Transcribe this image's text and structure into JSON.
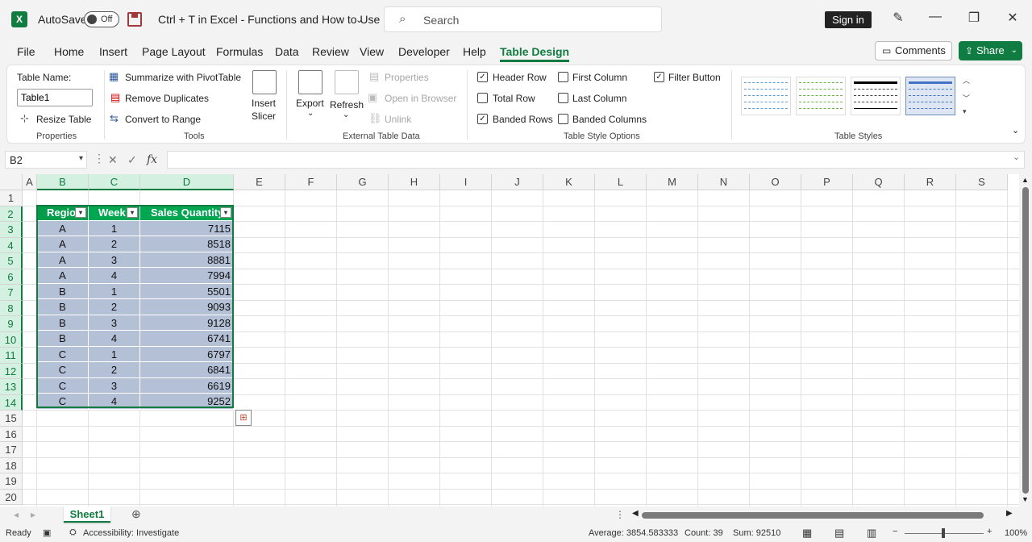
{
  "titlebar": {
    "app_icon": "excel-logo-icon",
    "logo_text": "X",
    "autosave_label": "AutoSave",
    "autosave_state": "Off",
    "doc_title": "Ctrl + T in Excel - Functions and How to Use It",
    "search_placeholder": "Search",
    "signin_label": "Sign in"
  },
  "menu": {
    "tabs": [
      "File",
      "Home",
      "Insert",
      "Page Layout",
      "Formulas",
      "Data",
      "Review",
      "View",
      "Developer",
      "Help",
      "Table Design"
    ],
    "active_tab": "Table Design",
    "comments_label": "Comments",
    "share_label": "Share"
  },
  "ribbon": {
    "properties": {
      "table_name_label": "Table Name:",
      "table_name_value": "Table1",
      "resize_label": "Resize Table",
      "group_label": "Properties"
    },
    "tools": {
      "pivot_label": "Summarize with PivotTable",
      "remove_dup_label": "Remove Duplicates",
      "convert_label": "Convert to Range",
      "group_label": "Tools"
    },
    "slicer": {
      "label1": "Insert",
      "label2": "Slicer"
    },
    "external": {
      "export_label": "Export",
      "refresh_label": "Refresh",
      "properties_label": "Properties",
      "open_browser_label": "Open in Browser",
      "unlink_label": "Unlink",
      "group_label": "External Table Data"
    },
    "style_options": {
      "header_row": "Header Row",
      "total_row": "Total Row",
      "banded_rows": "Banded Rows",
      "first_column": "First Column",
      "last_column": "Last Column",
      "banded_columns": "Banded Columns",
      "filter_button": "Filter Button",
      "group_label": "Table Style Options",
      "checked": {
        "header_row": true,
        "total_row": false,
        "banded_rows": true,
        "first_column": false,
        "last_column": false,
        "banded_columns": false,
        "filter_button": true
      }
    },
    "table_styles": {
      "group_label": "Table Styles"
    }
  },
  "formula_bar": {
    "name_box": "B2",
    "fx_label": "fx",
    "formula": ""
  },
  "grid": {
    "columns": [
      "A",
      "B",
      "C",
      "D",
      "E",
      "F",
      "G",
      "H",
      "I",
      "J",
      "K",
      "L",
      "M",
      "N",
      "O",
      "P",
      "Q",
      "R",
      "S"
    ],
    "rows": [
      "1",
      "2",
      "3",
      "4",
      "5",
      "6",
      "7",
      "8",
      "9",
      "10",
      "11",
      "12",
      "13",
      "14",
      "15",
      "16",
      "17",
      "18",
      "19",
      "20"
    ],
    "table_headers": [
      "Regio",
      "Week",
      "Sales Quantity"
    ],
    "table_rows": [
      [
        "A",
        "1",
        "7115"
      ],
      [
        "A",
        "2",
        "8518"
      ],
      [
        "A",
        "3",
        "8881"
      ],
      [
        "A",
        "4",
        "7994"
      ],
      [
        "B",
        "1",
        "5501"
      ],
      [
        "B",
        "2",
        "9093"
      ],
      [
        "B",
        "3",
        "9128"
      ],
      [
        "B",
        "4",
        "6741"
      ],
      [
        "C",
        "1",
        "6797"
      ],
      [
        "C",
        "2",
        "6841"
      ],
      [
        "C",
        "3",
        "6619"
      ],
      [
        "C",
        "4",
        "9252"
      ]
    ]
  },
  "sheets": {
    "active": "Sheet1"
  },
  "status": {
    "ready": "Ready",
    "accessibility": "Accessibility: Investigate",
    "average": "Average: 3854.583333",
    "count": "Count: 39",
    "sum": "Sum: 92510",
    "zoom": "100%"
  },
  "colors": {
    "accent": "#107c41",
    "table_header": "#00a650",
    "table_band": "#b4c0d6"
  }
}
